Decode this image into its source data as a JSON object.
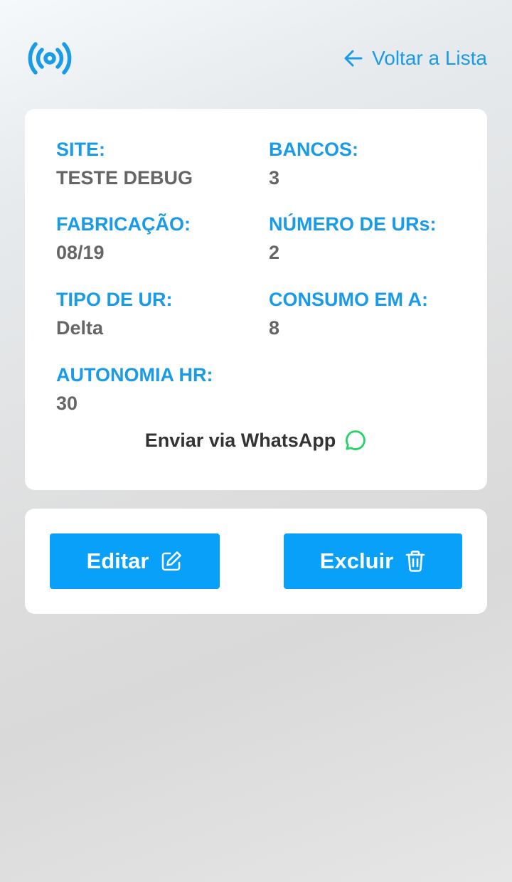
{
  "header": {
    "logo_icon": "broadcast-signal-icon",
    "back_icon": "arrow-left-icon",
    "back_label": "Voltar a Lista"
  },
  "details": {
    "site_label": "SITE:",
    "site_value": "TESTE DEBUG",
    "bancos_label": "BANCOS:",
    "bancos_value": "3",
    "fabricacao_label": "FABRICAÇÃO:",
    "fabricacao_value": "08/19",
    "numero_urs_label": "NÚMERO DE URs:",
    "numero_urs_value": "2",
    "tipo_ur_label": "TIPO DE UR:",
    "tipo_ur_value": "Delta",
    "consumo_label": "CONSUMO EM A:",
    "consumo_value": "8",
    "autonomia_label": "AUTONOMIA HR:",
    "autonomia_value": "30",
    "whatsapp_label": "Enviar via WhatsApp",
    "whatsapp_icon": "whatsapp-icon"
  },
  "actions": {
    "edit_label": "Editar",
    "edit_icon": "edit-icon",
    "delete_label": "Excluir",
    "delete_icon": "trash-icon"
  },
  "colors": {
    "accent": "#1a9be8",
    "button": "#08a0f8",
    "value_text": "#666666",
    "whatsapp": "#25d366"
  }
}
